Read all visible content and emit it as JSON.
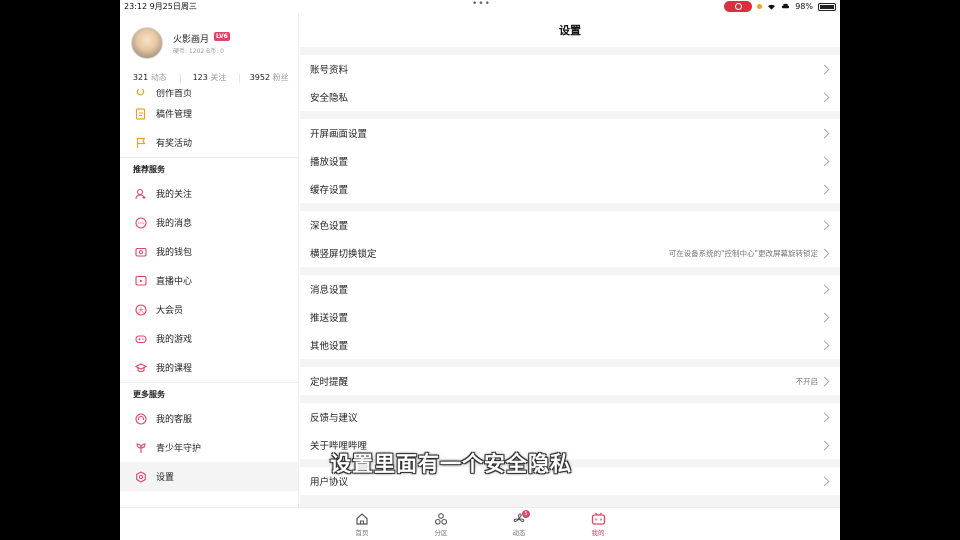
{
  "status_bar": {
    "time": "23:12  9月25日周三",
    "battery": "98%"
  },
  "profile": {
    "name": "火影画月",
    "level": "LV6",
    "coins": "硬币: 1202  B币: 0",
    "stats": [
      {
        "count": "321",
        "label": "动态"
      },
      {
        "count": "123",
        "label": "关注"
      },
      {
        "count": "3952",
        "label": "粉丝"
      }
    ]
  },
  "sidebar": {
    "top_items": [
      {
        "label": "创作首页",
        "icon": "bulb-icon"
      },
      {
        "label": "稿件管理",
        "icon": "manuscript-icon"
      },
      {
        "label": "有奖活动",
        "icon": "flag-icon"
      }
    ],
    "section_recommended": "推荐服务",
    "recommended_items": [
      {
        "label": "我的关注",
        "icon": "person-plus-icon"
      },
      {
        "label": "我的消息",
        "icon": "message-icon"
      },
      {
        "label": "我的钱包",
        "icon": "wallet-icon"
      },
      {
        "label": "直播中心",
        "icon": "live-icon"
      },
      {
        "label": "大会员",
        "icon": "vip-icon"
      },
      {
        "label": "我的游戏",
        "icon": "gamepad-icon"
      },
      {
        "label": "我的课程",
        "icon": "course-icon"
      }
    ],
    "section_more": "更多服务",
    "more_items": [
      {
        "label": "我的客服",
        "icon": "headset-icon"
      },
      {
        "label": "青少年守护",
        "icon": "leaf-icon"
      },
      {
        "label": "设置",
        "icon": "settings-icon"
      }
    ]
  },
  "main": {
    "title": "设置",
    "groups": [
      [
        {
          "label": "账号资料"
        },
        {
          "label": "安全隐私"
        }
      ],
      [
        {
          "label": "开屏画面设置"
        },
        {
          "label": "播放设置"
        },
        {
          "label": "缓存设置"
        }
      ],
      [
        {
          "label": "深色设置"
        },
        {
          "label": "横竖屏切换锁定",
          "value": "可在设备系统的\"控制中心\"更改屏幕旋转锁定"
        }
      ],
      [
        {
          "label": "消息设置"
        },
        {
          "label": "推送设置"
        },
        {
          "label": "其他设置"
        }
      ],
      [
        {
          "label": "定时提醒",
          "value": "不开启"
        }
      ],
      [
        {
          "label": "反馈与建议"
        },
        {
          "label": "关于哔哩哔哩"
        }
      ],
      [
        {
          "label": "用户协议"
        }
      ]
    ]
  },
  "tabbar": {
    "tabs": [
      {
        "label": "首页"
      },
      {
        "label": "分区"
      },
      {
        "label": "动态",
        "badge": "5"
      },
      {
        "label": "我的"
      }
    ]
  },
  "subtitle": "设置里面有一个安全隐私",
  "colors": {
    "accent": "#e14468",
    "background": "#f4f4f4"
  }
}
